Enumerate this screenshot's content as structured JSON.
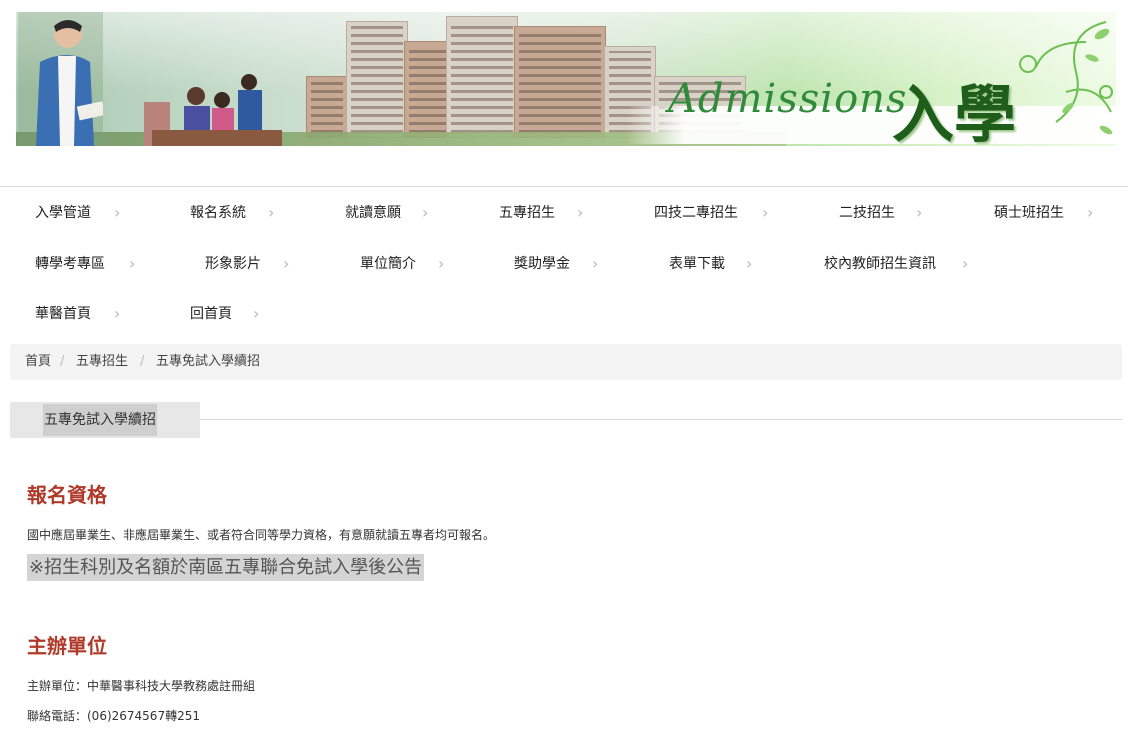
{
  "banner": {
    "brand_script": "Admissions",
    "brand_zh": "入學"
  },
  "nav": {
    "row1": [
      "入學管道",
      "報名系統",
      "就讀意願",
      "五專招生",
      "四技二專招生",
      "二技招生",
      "碩士班招生"
    ],
    "row2": [
      "轉學考專區",
      "形象影片",
      "單位簡介",
      "獎助學金",
      "表單下載",
      "校內教師招生資訊"
    ],
    "row3": [
      "華醫首頁",
      "回首頁"
    ],
    "chevron": "›"
  },
  "breadcrumb": {
    "items": [
      "首頁",
      "五專招生",
      "五專免試入學續招"
    ],
    "separator": "/"
  },
  "section_tab": {
    "label": "五專免試入學續招"
  },
  "content": {
    "eligibility": {
      "heading": "報名資格",
      "text": "國中應屆畢業生、非應屆畢業生、或者符合同等學力資格，有意願就讀五專者均可報名。",
      "notice": "※招生科別及名額於南區五專聯合免試入學後公告"
    },
    "organizer": {
      "heading": "主辦單位",
      "unit_line": "主辦單位：中華醫事科技大學教務處註冊組",
      "phone_line": "聯絡電話：(06)2674567轉251"
    }
  },
  "colors": {
    "heading": "#b03a2a",
    "banner_green": "#2f8a3a",
    "breadcrumb_bg": "#f3f3f3"
  }
}
